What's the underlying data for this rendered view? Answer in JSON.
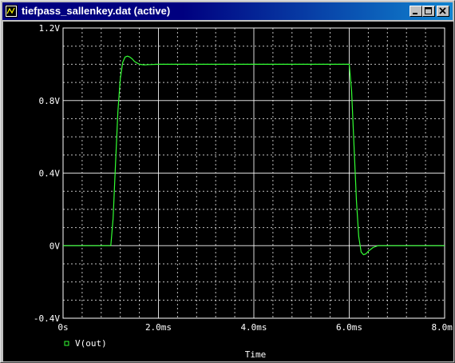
{
  "window": {
    "title": "tiefpass_sallenkey.dat (active)",
    "controls": [
      "minimize",
      "maximize",
      "close"
    ],
    "icons": {
      "app": "probe-app-icon",
      "minimize": "minimize-icon",
      "maximize": "maximize-icon",
      "close": "close-icon"
    }
  },
  "colors": {
    "background": "#000000",
    "grid": "#ffffff",
    "trace": "#33ff33",
    "titlebar": "#000080"
  },
  "chart_data": {
    "type": "line",
    "title": "",
    "xlabel": "Time",
    "ylabel": "",
    "xlim": [
      0,
      8
    ],
    "ylim": [
      -0.4,
      1.2
    ],
    "x_unit": "ms",
    "y_unit": "V",
    "xticks": [
      0,
      2,
      4,
      6,
      8
    ],
    "xtick_labels": [
      "0s",
      "2.0ms",
      "4.0ms",
      "6.0ms",
      "8.0ms"
    ],
    "yticks": [
      -0.4,
      0,
      0.4,
      0.8,
      1.2
    ],
    "ytick_labels": [
      "-0.4V",
      "0V",
      "0.4V",
      "0.8V",
      "1.2V"
    ],
    "grid": true,
    "legend": "bottom-left",
    "series": [
      {
        "name": "V(out)",
        "color": "#33ff33",
        "x": [
          0,
          1.0,
          1.05,
          1.1,
          1.15,
          1.2,
          1.25,
          1.3,
          1.35,
          1.4,
          1.45,
          1.5,
          1.6,
          1.7,
          1.8,
          2.0,
          3.0,
          4.0,
          5.0,
          6.0,
          6.05,
          6.1,
          6.15,
          6.2,
          6.25,
          6.3,
          6.35,
          6.4,
          6.5,
          6.6,
          6.8,
          7.0,
          8.0
        ],
        "values": [
          0,
          0,
          0.15,
          0.45,
          0.74,
          0.92,
          1.01,
          1.04,
          1.045,
          1.04,
          1.03,
          1.015,
          1.0,
          0.997,
          0.998,
          1.0,
          1.0,
          1.0,
          1.0,
          1.0,
          0.85,
          0.55,
          0.25,
          0.05,
          -0.035,
          -0.05,
          -0.045,
          -0.03,
          -0.01,
          0.0,
          0.0,
          0.0,
          0.0
        ]
      }
    ]
  }
}
